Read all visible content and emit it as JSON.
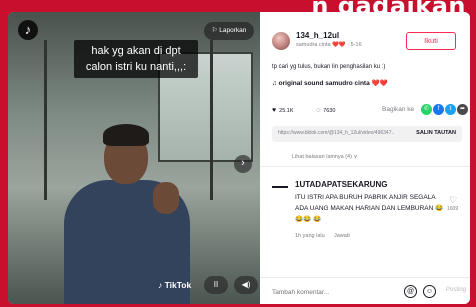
{
  "banner": {
    "title": "n gadaikan"
  },
  "video": {
    "logo": "tiktok-logo",
    "caption_line1": "hak yg akan di dpt",
    "caption_line2": "calon istri ku nanti,,,:",
    "report_label": "Laporkan",
    "next_glyph": "›",
    "watermark": "♪ TikTok",
    "pause_glyph": "II",
    "volume_glyph": "◀)"
  },
  "post": {
    "username": "134_h_12ul",
    "subtitle": "samudra cinta ❤️❤️ · 5-16",
    "follow_label": "Ikuti",
    "description": "tp cari yg tulus, bukan lin penghasilan ku :)",
    "sound": "♫  original sound samudro cinta ❤️❤️",
    "likes": "25.1K",
    "comments": "7630",
    "share_label": "Bagikan ke",
    "link_url": "https://www.tiktok.com/@134_h_12ul/video/496347...",
    "copy_label": "SALIN TAUTAN",
    "others_label": "Lihat balasan lainnya (4) ∨"
  },
  "comment": {
    "name": "1UTADAPATSEKARUNG",
    "text": "ITU ISTRI APA BURUH PABRIK ANJIR SEGALA ADA UANG MAKAN HARIAN DAN LEMBURAN 😂😂😂 😂",
    "time": "1h yang lalu",
    "reply_label": "Jawab",
    "likes": "1609"
  },
  "input": {
    "placeholder": "Tambah komentar...",
    "at_glyph": "@",
    "emoji_glyph": "☺",
    "post_label": "Posting"
  },
  "colors": {
    "brand_red": "#c8102e",
    "tiktok_pink": "#fe2c55",
    "whatsapp": "#25d366",
    "facebook": "#1877f2",
    "twitter": "#1da1f2",
    "more": "#4a4a4a"
  }
}
